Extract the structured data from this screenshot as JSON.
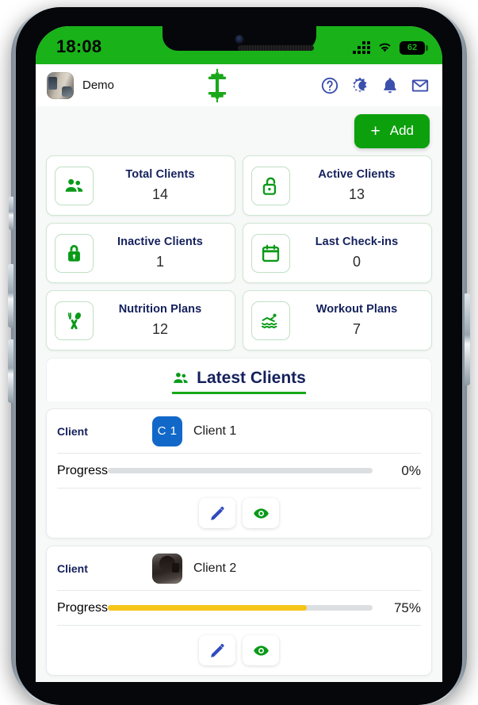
{
  "status_bar": {
    "time": "18:08",
    "signal_icon": "signal-bars-icon",
    "wifi_icon": "wifi-icon",
    "battery_level": "62"
  },
  "header": {
    "avatar_name": "demo-avatar",
    "account_name": "Demo",
    "logo_icon": "dumbbell-logo-icon",
    "icons": [
      {
        "name": "help-icon",
        "label": "Help"
      },
      {
        "name": "dark-mode-icon",
        "label": "Dark mode"
      },
      {
        "name": "notifications-bell-icon",
        "label": "Notifications"
      },
      {
        "name": "mail-envelope-icon",
        "label": "Messages"
      }
    ]
  },
  "toolbar": {
    "add_plus": "+",
    "add_label": "Add"
  },
  "stats": [
    {
      "label": "Total Clients",
      "value": "14",
      "icon": "people-icon"
    },
    {
      "label": "Active Clients",
      "value": "13",
      "icon": "lock-open-icon"
    },
    {
      "label": "Inactive Clients",
      "value": "1",
      "icon": "lock-closed-icon"
    },
    {
      "label": "Last Check-ins",
      "value": "0",
      "icon": "calendar-icon"
    },
    {
      "label": "Nutrition Plans",
      "value": "12",
      "icon": "fork-spoon-icon"
    },
    {
      "label": "Workout Plans",
      "value": "7",
      "icon": "swimmer-icon"
    }
  ],
  "latest": {
    "icon": "people-icon",
    "title": "Latest Clients",
    "row_label_client": "Client",
    "row_label_progress": "Progress",
    "clients": [
      {
        "row_label": "Client",
        "avatar_type": "initials",
        "initials": "C 1",
        "name": "Client 1",
        "progress_label": "Progress",
        "progress_value": 0,
        "progress_text": "0%",
        "edit_icon": "pencil-edit-icon",
        "view_icon": "eye-view-icon"
      },
      {
        "row_label": "Client",
        "avatar_type": "photo",
        "initials": "",
        "name": "Client 2",
        "progress_label": "Progress",
        "progress_value": 75,
        "progress_text": "75%",
        "edit_icon": "pencil-edit-icon",
        "view_icon": "eye-view-icon"
      }
    ]
  },
  "colors": {
    "brand_green": "#19b219",
    "add_green": "#0da00d",
    "icon_green": "#0a9a18",
    "header_icon_blue": "#3b4fad",
    "title_navy": "#14205c",
    "badge_blue": "#1268c9",
    "progress_yellow": "#f5c518",
    "progress_track": "#dcdfe2",
    "page_bg": "#f7f8f8"
  }
}
